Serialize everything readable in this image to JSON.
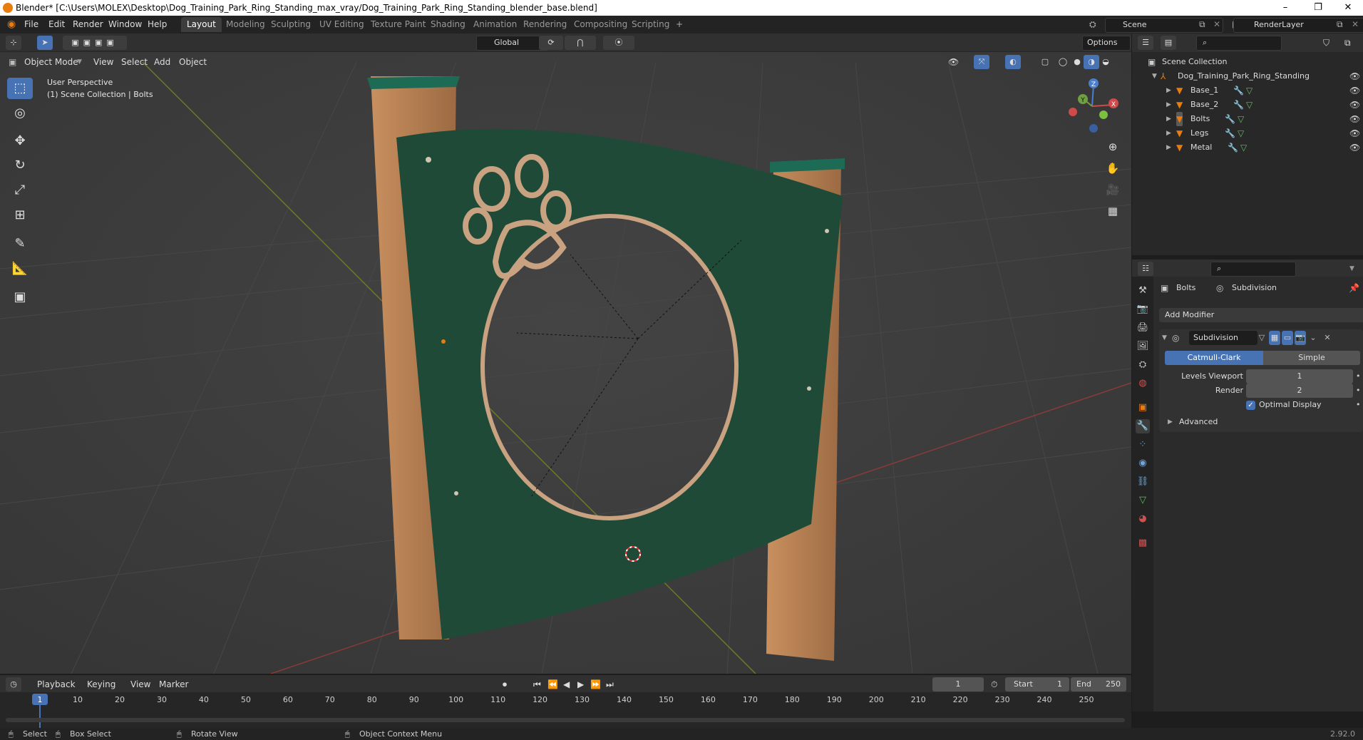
{
  "window": {
    "title": "Blender* [C:\\Users\\MOLEX\\Desktop\\Dog_Training_Park_Ring_Standing_max_vray/Dog_Training_Park_Ring_Standing_blender_base.blend]",
    "minimize": "–",
    "maximize": "❐",
    "close": "✕"
  },
  "menu": [
    "File",
    "Edit",
    "Render",
    "Window",
    "Help"
  ],
  "workspaces": [
    "Layout",
    "Modeling",
    "Sculpting",
    "UV Editing",
    "Texture Paint",
    "Shading",
    "Animation",
    "Rendering",
    "Compositing",
    "Scripting"
  ],
  "active_workspace": "Layout",
  "scene": {
    "label": "Scene",
    "render_layer": "RenderLayer"
  },
  "viewport_header": {
    "transform_orientation": "Global",
    "options": "Options",
    "mode": "Object Mode",
    "menus": [
      "View",
      "Select",
      "Add",
      "Object"
    ]
  },
  "viewport": {
    "perspective": "User Perspective",
    "collection_info": "(1) Scene Collection | Bolts"
  },
  "gizmo": {
    "x": "X",
    "y": "Y",
    "z": "Z"
  },
  "outliner": {
    "root": "Scene Collection",
    "collection": "Dog_Training_Park_Ring_Standing",
    "objects": [
      "Base_1",
      "Base_2",
      "Bolts",
      "Legs",
      "Metal"
    ]
  },
  "properties": {
    "object_name": "Bolts",
    "modifier_tab": "Subdivision",
    "add_modifier": "Add Modifier",
    "modifier_name": "Subdivision",
    "algorithms": [
      "Catmull-Clark",
      "Simple"
    ],
    "active_algorithm": "Catmull-Clark",
    "levels_viewport_label": "Levels Viewport",
    "levels_viewport": "1",
    "render_label": "Render",
    "render": "2",
    "optimal_display_label": "Optimal Display",
    "optimal_display": true,
    "advanced_label": "Advanced"
  },
  "timeline": {
    "menus": [
      "Playback",
      "Keying",
      "View",
      "Marker"
    ],
    "current_frame": "1",
    "start_label": "Start",
    "start": "1",
    "end_label": "End",
    "end": "250",
    "ticks": [
      "1",
      "10",
      "20",
      "30",
      "40",
      "50",
      "60",
      "70",
      "80",
      "90",
      "100",
      "110",
      "120",
      "130",
      "140",
      "150",
      "160",
      "170",
      "180",
      "190",
      "200",
      "210",
      "220",
      "230",
      "240",
      "250"
    ]
  },
  "statusbar": {
    "select": "Select",
    "box_select": "Box Select",
    "rotate_view": "Rotate View",
    "context_menu": "Object Context Menu",
    "version": "2.92.0"
  },
  "colors": {
    "accent": "#4772b3",
    "panel_green": "#1f4a38",
    "wood": "#b07a4f",
    "object_orange": "#e87d0d"
  }
}
